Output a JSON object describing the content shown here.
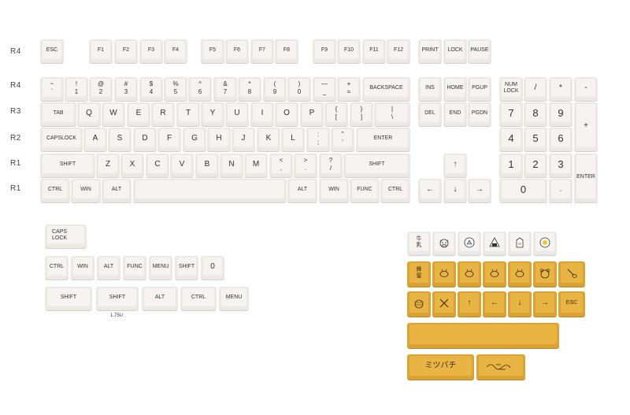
{
  "row_labels": [
    "R4",
    "R4",
    "R3",
    "R2",
    "R1",
    "R1"
  ],
  "function_row": {
    "esc": "ESC",
    "f_keys": [
      "F1",
      "F2",
      "F3",
      "F4",
      "F5",
      "F6",
      "F7",
      "F8",
      "F9",
      "F10",
      "F11",
      "F12"
    ],
    "print": "PRINT",
    "lock": "LOCK",
    "pause": "PAUSE"
  },
  "number_row": {
    "keys": [
      "~\n`",
      "!\n1",
      "@\n2",
      "#\n3",
      "$\n4",
      "%\n5",
      "^\n6",
      "&\n7",
      "*\n8",
      "(\n9",
      ")\n0",
      "—\n_",
      "+\n="
    ],
    "backspace": "BACKSPACE"
  },
  "tab_row": {
    "tab": "TAB",
    "keys": [
      "Q",
      "W",
      "E",
      "R",
      "T",
      "Y",
      "U",
      "I",
      "O",
      "P",
      "{\n[",
      "}\n]",
      "|\n\\"
    ]
  },
  "caps_row": {
    "capslock": "CAPSLOCK",
    "keys": [
      "A",
      "S",
      "D",
      "F",
      "G",
      "H",
      "J",
      "K",
      "L",
      ":\n;",
      "\"\n'"
    ],
    "enter": "ENTER"
  },
  "shift_row": {
    "shift_left": "SHIFT",
    "keys": [
      "Z",
      "X",
      "C",
      "V",
      "B",
      "N",
      "M",
      "<\n,",
      ">\n.",
      "?\n/"
    ],
    "shift_right": "SHIFT"
  },
  "bottom_row": {
    "ctrl": "CTRL",
    "win": "WIN",
    "alt": "ALT",
    "alt_right": "ALT",
    "win_right": "WIN",
    "func": "FUNC",
    "ctrl_right": "CTRL"
  },
  "nav_cluster": {
    "ins": "INS",
    "home": "HOME",
    "pgup": "PGUP",
    "del": "DEL",
    "end": "END",
    "pgdn": "PGDN",
    "up": "↑",
    "left": "←",
    "down": "↓",
    "right": "→"
  },
  "numpad": {
    "numlock": "NUM\nLOCK",
    "slash": "/",
    "asterisk": "*",
    "minus": "-",
    "seven": "7",
    "eight": "8",
    "nine": "9",
    "plus": "+",
    "four": "4",
    "five": "5",
    "six": "6",
    "one": "1",
    "two": "2",
    "three": "3",
    "enter": "ENTER",
    "zero": "0",
    "dot": "."
  },
  "extras": {
    "capslock": "CAPS\nLOCK",
    "mods": [
      "CTRL",
      "WIN",
      "ALT",
      "FUNC",
      "MENU",
      "SHIFT",
      "0"
    ],
    "wide": [
      "SHIFT",
      "SHIFT",
      "ALT",
      "CTRL",
      "MENU"
    ],
    "caption_175u": "1.75U"
  },
  "novelties": {
    "white_row": [
      "cow-milk-icon",
      "cow-face-icon",
      "milk-bottle-icon",
      "onigiri-icon",
      "milk-carton-icon",
      "egg-icon"
    ],
    "white_row_text": [
      "牛\n乳"
    ],
    "yellow_row1": [
      "honeycomb-kanji-icon",
      "bee-icon",
      "bee-icon",
      "bee-icon",
      "bee-icon",
      "bear-icon",
      "honey-dipper-icon"
    ],
    "yellow_row1_text": [
      "蜂\n蜜"
    ],
    "yellow_row2": {
      "hive": "hive-icon",
      "cross": "crossed-dippers-icon",
      "up": "↑",
      "left": "←",
      "down": "↓",
      "right": "→",
      "esc": "ESC"
    },
    "spacebar_text": "ミツバチ",
    "signature_label": "signature"
  },
  "colors": {
    "key": "#ece8e4",
    "cap": "#f6f3f0",
    "honey": "#dca232",
    "honey_top": "#e8b443"
  }
}
